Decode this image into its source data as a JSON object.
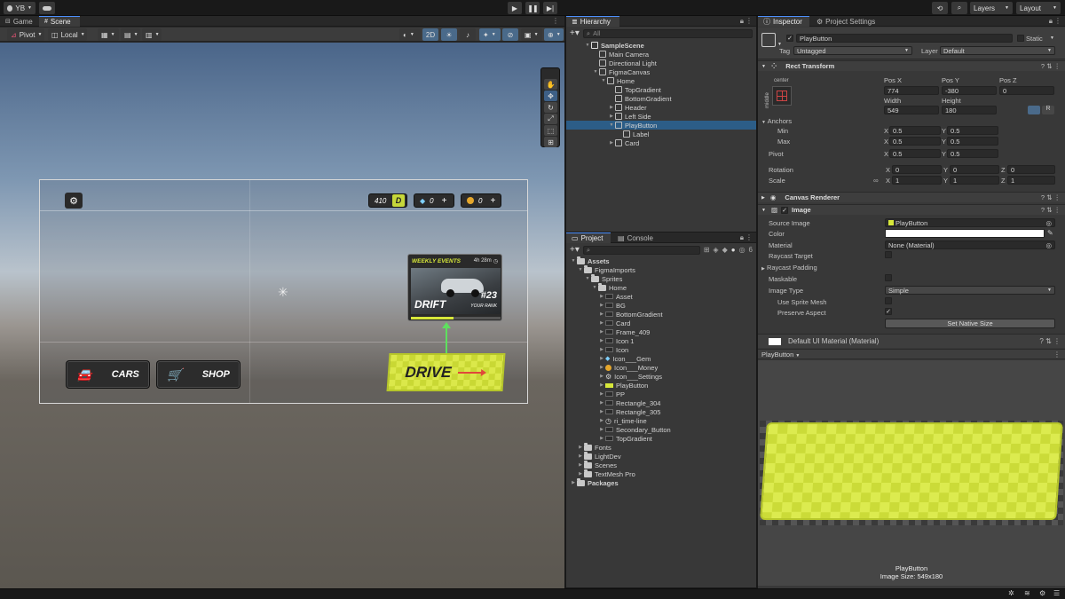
{
  "topbar": {
    "account": "YB",
    "layers": "Layers",
    "layout": "Layout"
  },
  "scene": {
    "tabs": [
      "Game",
      "Scene"
    ],
    "pivot": "Pivot",
    "local": "Local",
    "mode_2d": "2D"
  },
  "game_ui": {
    "level": "410",
    "level_badge": "D",
    "gems": "0",
    "money": "0",
    "weekly_title": "WEEKLY EVENTS",
    "weekly_timer": "4h 28m",
    "weekly_event": "DRIFT",
    "rank_number": "#23",
    "rank_label": "YOUR RANK",
    "cars": "CARS",
    "shop": "SHOP",
    "drive": "DRIVE"
  },
  "hierarchy": {
    "tab": "Hierarchy",
    "search_placeholder": "All",
    "items": [
      {
        "label": "SampleScene",
        "depth": 0,
        "bold": true,
        "arrow": "down",
        "icon": "unity-scene"
      },
      {
        "label": "Main Camera",
        "depth": 1,
        "arrow": "",
        "icon": "cube"
      },
      {
        "label": "Directional Light",
        "depth": 1,
        "arrow": "",
        "icon": "cube"
      },
      {
        "label": "FigmaCanvas",
        "depth": 1,
        "arrow": "down",
        "icon": "cube"
      },
      {
        "label": "Home",
        "depth": 2,
        "arrow": "down",
        "icon": "cube"
      },
      {
        "label": "TopGradient",
        "depth": 3,
        "arrow": "",
        "icon": "cube"
      },
      {
        "label": "BottomGradient",
        "depth": 3,
        "arrow": "",
        "icon": "cube"
      },
      {
        "label": "Header",
        "depth": 3,
        "arrow": "right",
        "icon": "cube"
      },
      {
        "label": "Left Side",
        "depth": 3,
        "arrow": "right",
        "icon": "cube"
      },
      {
        "label": "PlayButton",
        "depth": 3,
        "arrow": "down",
        "icon": "cube",
        "selected": true
      },
      {
        "label": "Label",
        "depth": 4,
        "arrow": "",
        "icon": "cube"
      },
      {
        "label": "Card",
        "depth": 3,
        "arrow": "right",
        "icon": "cube"
      }
    ]
  },
  "project": {
    "tabs": [
      "Project",
      "Console"
    ],
    "badge_count": "6",
    "items": [
      {
        "label": "Assets",
        "depth": 0,
        "bold": true,
        "arrow": "down",
        "icon": "folder"
      },
      {
        "label": "FigmaImports",
        "depth": 1,
        "arrow": "down",
        "icon": "folder"
      },
      {
        "label": "Sprites",
        "depth": 2,
        "arrow": "down",
        "icon": "folder"
      },
      {
        "label": "Home",
        "depth": 3,
        "arrow": "down",
        "icon": "folder"
      },
      {
        "label": "Asset",
        "depth": 4,
        "arrow": "right",
        "icon": "sprite"
      },
      {
        "label": "BG",
        "depth": 4,
        "arrow": "right",
        "icon": "sprite"
      },
      {
        "label": "BottomGradient",
        "depth": 4,
        "arrow": "right",
        "icon": "sprite"
      },
      {
        "label": "Card",
        "depth": 4,
        "arrow": "right",
        "icon": "sprite"
      },
      {
        "label": "Frame_409",
        "depth": 4,
        "arrow": "right",
        "icon": "sprite"
      },
      {
        "label": "Icon 1",
        "depth": 4,
        "arrow": "right",
        "icon": "sprite"
      },
      {
        "label": "Icon",
        "depth": 4,
        "arrow": "right",
        "icon": "sprite"
      },
      {
        "label": "Icon___Gem",
        "depth": 4,
        "arrow": "right",
        "icon": "gem"
      },
      {
        "label": "Icon___Money",
        "depth": 4,
        "arrow": "right",
        "icon": "coin"
      },
      {
        "label": "Icon___Settings",
        "depth": 4,
        "arrow": "right",
        "icon": "gear"
      },
      {
        "label": "PlayButton",
        "depth": 4,
        "arrow": "right",
        "icon": "play-sprite"
      },
      {
        "label": "PP",
        "depth": 4,
        "arrow": "right",
        "icon": "sprite"
      },
      {
        "label": "Rectangle_304",
        "depth": 4,
        "arrow": "right",
        "icon": "sprite"
      },
      {
        "label": "Rectangle_305",
        "depth": 4,
        "arrow": "right",
        "icon": "sprite"
      },
      {
        "label": "ri_time-line",
        "depth": 4,
        "arrow": "right",
        "icon": "clock"
      },
      {
        "label": "Secondary_Button",
        "depth": 4,
        "arrow": "right",
        "icon": "sprite"
      },
      {
        "label": "TopGradient",
        "depth": 4,
        "arrow": "right",
        "icon": "sprite"
      },
      {
        "label": "Fonts",
        "depth": 1,
        "arrow": "right",
        "icon": "folder"
      },
      {
        "label": "LightDev",
        "depth": 1,
        "arrow": "right",
        "icon": "folder"
      },
      {
        "label": "Scenes",
        "depth": 1,
        "arrow": "right",
        "icon": "folder"
      },
      {
        "label": "TextMesh Pro",
        "depth": 1,
        "arrow": "right",
        "icon": "folder"
      },
      {
        "label": "Packages",
        "depth": 0,
        "bold": true,
        "arrow": "right",
        "icon": "folder"
      }
    ]
  },
  "inspector": {
    "tabs": [
      "Inspector",
      "Project Settings"
    ],
    "object_name": "PlayButton",
    "static_label": "Static",
    "tag_label": "Tag",
    "tag_value": "Untagged",
    "layer_label": "Layer",
    "layer_value": "Default",
    "rect_transform": "Rect Transform",
    "anchor_preset_top": "center",
    "anchor_preset_side": "middle",
    "pos_x_label": "Pos X",
    "pos_x": "774",
    "pos_y_label": "Pos Y",
    "pos_y": "-380",
    "pos_z_label": "Pos Z",
    "pos_z": "0",
    "width_label": "Width",
    "width": "549",
    "height_label": "Height",
    "height": "180",
    "anchors": "Anchors",
    "min": "Min",
    "min_x": "0.5",
    "min_y": "0.5",
    "max": "Max",
    "max_x": "0.5",
    "max_y": "0.5",
    "pivot": "Pivot",
    "pivot_x": "0.5",
    "pivot_y": "0.5",
    "rotation": "Rotation",
    "rot_x": "0",
    "rot_y": "0",
    "rot_z": "0",
    "scale": "Scale",
    "scale_x": "1",
    "scale_y": "1",
    "scale_z": "1",
    "canvas_renderer": "Canvas Renderer",
    "image": "Image",
    "source_image_label": "Source Image",
    "source_image": "PlayButton",
    "color_label": "Color",
    "material_label": "Material",
    "material": "None (Material)",
    "raycast_target": "Raycast Target",
    "raycast_padding": "Raycast Padding",
    "maskable": "Maskable",
    "image_type_label": "Image Type",
    "image_type": "Simple",
    "use_sprite_mesh": "Use Sprite Mesh",
    "preserve_aspect": "Preserve Aspect",
    "set_native_size": "Set Native Size",
    "default_material": "Default UI Material (Material)",
    "preview_dropdown": "PlayButton",
    "preview_name": "PlayButton",
    "preview_size": "Image Size: 549x180",
    "xyz": [
      "X",
      "Y",
      "Z"
    ]
  },
  "colors": {
    "accent_yellow": "#d7e83a",
    "selection": "#2c5d87",
    "panel": "#383838"
  }
}
